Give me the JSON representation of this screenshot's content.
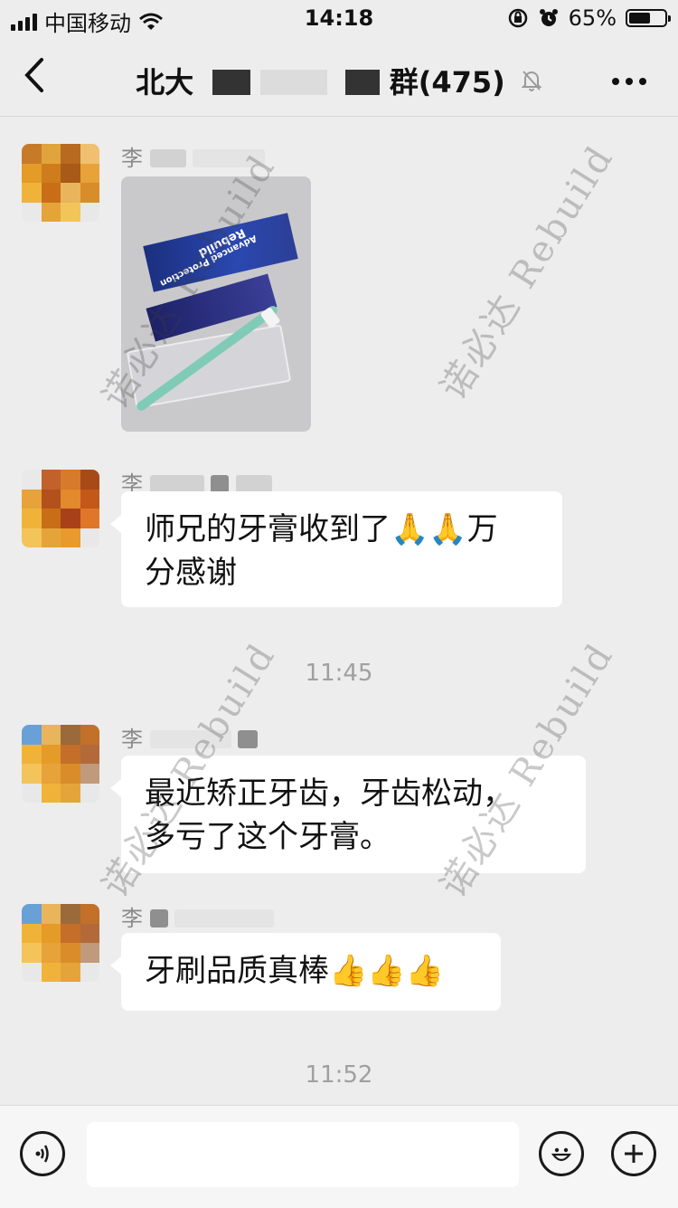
{
  "status_bar": {
    "carrier": "中国移动",
    "time": "14:18",
    "battery_percent": "65%",
    "battery_level": 0.65
  },
  "nav": {
    "back_icon": "chevron-left-icon",
    "title_prefix": "北大",
    "title_suffix": "群(475)",
    "more_icon": "more-dots-icon",
    "muted": true
  },
  "messages": [
    {
      "sender": "李",
      "type": "image",
      "image_brand": "Rebuild",
      "image_text": "Advanced Protection"
    },
    {
      "sender": "李",
      "type": "text",
      "text_line1": "师兄的牙膏收到了🙏🙏万",
      "text_line2": "分感谢"
    },
    {
      "type": "time",
      "time": "11:45"
    },
    {
      "sender": "李",
      "type": "text",
      "text_line1": "最近矫正牙齿，牙齿松动，",
      "text_line2": "多亏了这个牙膏。"
    },
    {
      "sender": "李",
      "type": "text",
      "text_line1": "牙刷品质真棒👍👍👍"
    },
    {
      "type": "time",
      "time": "11:52"
    }
  ],
  "watermark": "诺必达 Rebuild",
  "input_bar": {
    "voice_icon": "voice-icon",
    "input_value": "",
    "emoji_icon": "emoji-icon",
    "plus_icon": "plus-icon"
  },
  "colors": {
    "background": "#ededed",
    "bubble": "#ffffff",
    "timestamp": "#a0a0a0"
  }
}
